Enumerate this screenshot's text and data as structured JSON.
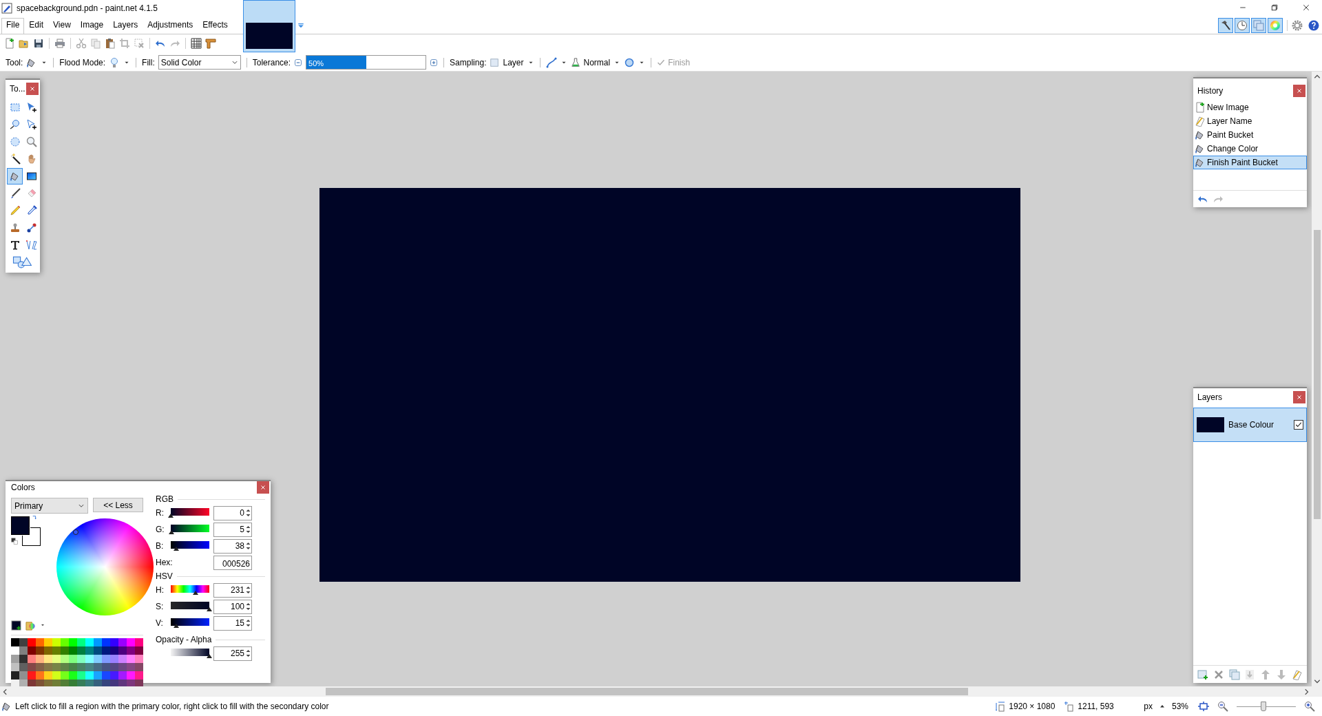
{
  "window": {
    "title": "spacebackground.pdn - paint.net 4.1.5"
  },
  "menu": [
    {
      "label": "File",
      "selected": true
    },
    {
      "label": "Edit",
      "selected": false
    },
    {
      "label": "View",
      "selected": false
    },
    {
      "label": "Image",
      "selected": false
    },
    {
      "label": "Layers",
      "selected": false
    },
    {
      "label": "Adjustments",
      "selected": false
    },
    {
      "label": "Effects",
      "selected": false
    }
  ],
  "document_tabs": [
    {
      "selected": true
    }
  ],
  "panel_toggles": [
    {
      "kind": "tools",
      "selected": true
    },
    {
      "kind": "history",
      "selected": true
    },
    {
      "kind": "layers",
      "selected": true
    },
    {
      "kind": "colors",
      "selected": true
    }
  ],
  "tool_options": {
    "tool_label": "Tool:",
    "flood_mode_label": "Flood Mode:",
    "fill_label": "Fill:",
    "fill": "Solid Color",
    "tolerance_label": "Tolerance:",
    "tolerance": {
      "reading": "50%",
      "level": 0.5
    },
    "sampling_label": "Sampling:",
    "sampling": "Layer",
    "blend_mode": "Normal",
    "finish": {
      "label": "Finish",
      "disabled": true
    }
  },
  "tools_panel": {
    "title": "To...",
    "tools": [
      {
        "kind": "rectangle_select",
        "selected": false
      },
      {
        "kind": "move_selection",
        "selected": false
      },
      {
        "kind": "lasso",
        "selected": false
      },
      {
        "kind": "move_selected",
        "selected": false
      },
      {
        "kind": "ellipse_select",
        "selected": false
      },
      {
        "kind": "zoom",
        "selected": false
      },
      {
        "kind": "magic_wand",
        "selected": false
      },
      {
        "kind": "pan",
        "selected": false
      },
      {
        "kind": "paint_bucket",
        "selected": true
      },
      {
        "kind": "gradient",
        "selected": false
      },
      {
        "kind": "paintbrush",
        "selected": false
      },
      {
        "kind": "eraser",
        "selected": false
      },
      {
        "kind": "pencil",
        "selected": false
      },
      {
        "kind": "color_picker",
        "selected": false
      },
      {
        "kind": "clone_stamp",
        "selected": false
      },
      {
        "kind": "recolor",
        "selected": false
      },
      {
        "kind": "text",
        "selected": false
      },
      {
        "kind": "line",
        "selected": false
      },
      {
        "kind": "shapes",
        "selected": false
      }
    ]
  },
  "history": {
    "title": "History",
    "items": [
      {
        "kind": "new_image",
        "label": "New Image",
        "selected": false
      },
      {
        "kind": "layer_name",
        "label": "Layer Name",
        "selected": false
      },
      {
        "kind": "paint_bucket",
        "label": "Paint Bucket",
        "selected": false
      },
      {
        "kind": "paint_bucket",
        "label": "Change Color",
        "selected": false
      },
      {
        "kind": "paint_bucket",
        "label": "Finish Paint Bucket",
        "selected": true
      }
    ],
    "undo": {
      "disabled": false
    },
    "redo": {
      "disabled": true
    }
  },
  "layers": {
    "title": "Layers",
    "items": [
      {
        "name": "Base Colour",
        "visible": true,
        "selected": true
      }
    ]
  },
  "colors": {
    "title": "Colors",
    "mode": "Primary",
    "less_button": "<< Less",
    "swatches": [
      {
        "kind": "primary",
        "color": "#000526"
      },
      {
        "kind": "secondary",
        "color": "#ffffff"
      }
    ],
    "rgb_heading": "RGB",
    "rgb": [
      {
        "kind": "red",
        "label": "R:",
        "value": "0",
        "level": 0
      },
      {
        "kind": "green",
        "label": "G:",
        "value": "5",
        "level": 0.02
      },
      {
        "kind": "blue",
        "label": "B:",
        "value": "38",
        "level": 0.15
      }
    ],
    "hex": {
      "label": "Hex:",
      "value": "000526"
    },
    "hsv_heading": "HSV",
    "hsv": [
      {
        "kind": "hue",
        "label": "H:",
        "value": "231",
        "level": 0.64
      },
      {
        "kind": "saturation",
        "label": "S:",
        "value": "100",
        "level": 1
      },
      {
        "kind": "value",
        "label": "V:",
        "value": "15",
        "level": 0.15
      }
    ],
    "opacity_heading": "Opacity - Alpha",
    "alpha": {
      "value": "255",
      "level": 1
    }
  },
  "status_bar": {
    "hint": "Left click to fill a region with the primary color, right click to fill with the secondary color",
    "image_size": "1920 × 1080",
    "cursor": "1211, 593",
    "unit": "px",
    "zoom": "53%",
    "zoom_slider": {
      "level": 0.45
    }
  }
}
